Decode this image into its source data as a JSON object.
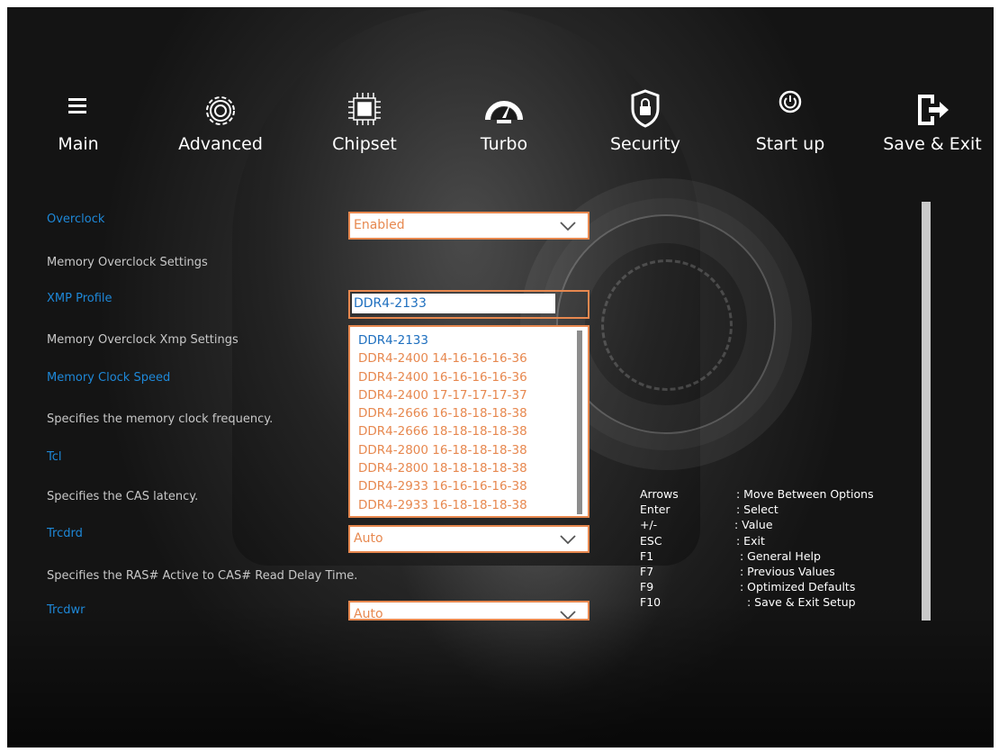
{
  "nav": {
    "main": "Main",
    "advanced": "Advanced",
    "chipset": "Chipset",
    "turbo": "Turbo",
    "security": "Security",
    "startup": "Start up",
    "save_exit": "Save & Exit"
  },
  "settings": {
    "overclock_label": "Overclock",
    "overclock_value": "Enabled",
    "memory_overclock_settings": "Memory Overclock Settings",
    "xmp_profile_label": "XMP Profile",
    "xmp_profile_value": "DDR4-2133",
    "memory_overclock_xmp_settings": "Memory Overclock Xmp Settings",
    "memory_clock_speed_label": "Memory Clock Speed",
    "memory_clock_speed_desc": "Specifies the memory clock frequency.",
    "tcl_label": "Tcl",
    "tcl_desc": "Specifies the CAS latency.",
    "trcdrd_label": "Trcdrd",
    "trcdrd_value": "Auto",
    "trcdrd_desc": "Specifies the RAS# Active to CAS# Read Delay Time.",
    "trcdwr_label": "Trcdwr",
    "trcdwr_value": "Auto"
  },
  "dropdown": {
    "options": [
      "DDR4-2133",
      "DDR4-2400 14-16-16-16-36",
      "DDR4-2400 16-16-16-16-36",
      "DDR4-2400 17-17-17-17-37",
      "DDR4-2666 16-18-18-18-38",
      "DDR4-2666 18-18-18-18-38",
      "DDR4-2800 16-18-18-18-38",
      "DDR4-2800 18-18-18-18-38",
      "DDR4-2933 16-16-16-16-38",
      "DDR4-2933 16-18-18-18-38"
    ],
    "selected_index": 0
  },
  "help": [
    {
      "key": "Arrows",
      "desc": ": Move Between Options"
    },
    {
      "key": "Enter",
      "desc": ": Select"
    },
    {
      "key": "+/-",
      "desc": ": Value"
    },
    {
      "key": "ESC",
      "desc": ": Exit"
    },
    {
      "key": "F1",
      "desc": ": General Help"
    },
    {
      "key": "F7",
      "desc": ": Previous Values"
    },
    {
      "key": "F9",
      "desc": ": Optimized Defaults"
    },
    {
      "key": "F10",
      "desc": ": Save & Exit Setup"
    }
  ],
  "colors": {
    "accent_orange": "#e7884f",
    "label_blue": "#1e88d8",
    "selected_blue": "#1e6fbf"
  },
  "icons": [
    "menu-icon",
    "gear-icon",
    "chip-icon",
    "speedometer-icon",
    "shield-lock-icon",
    "power-icon",
    "exit-icon"
  ]
}
